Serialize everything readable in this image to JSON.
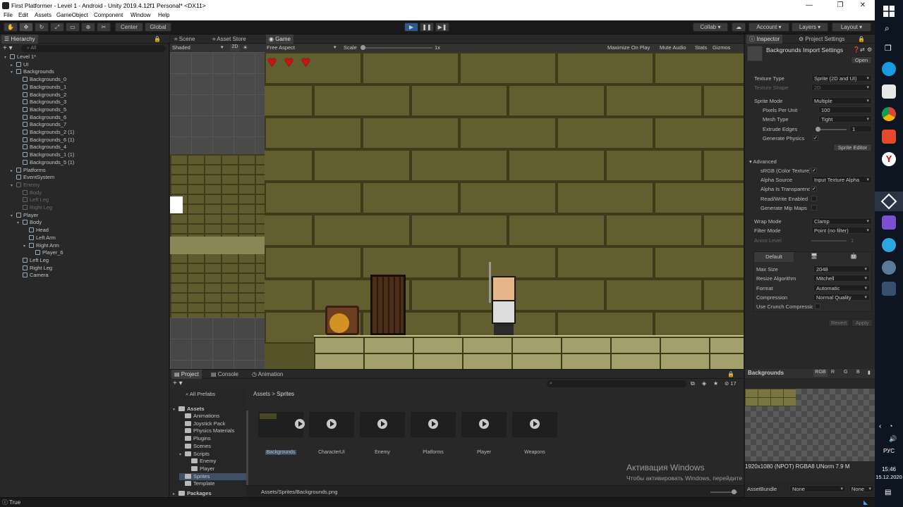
{
  "window": {
    "title": "First Platformer - Level 1 - Android - Unity 2019.4.12f1 Personal* <DX11>"
  },
  "menu": [
    "File",
    "Edit",
    "Assets",
    "GameObject",
    "Component",
    "Window",
    "Help"
  ],
  "toolbar": {
    "center_label": "Center",
    "global_label": "Global",
    "collab_label": "Collab",
    "account_label": "Account",
    "layers_label": "Layers",
    "layout_label": "Layout"
  },
  "hierarchy": {
    "title": "Hierarchy",
    "search_placeholder": "All",
    "items": [
      {
        "label": "Level 1*",
        "indent": 0,
        "dim": false
      },
      {
        "label": "UI",
        "indent": 1,
        "dim": false
      },
      {
        "label": "Backgrounds",
        "indent": 1,
        "dim": false
      },
      {
        "label": "Backgrounds_0",
        "indent": 2,
        "dim": false
      },
      {
        "label": "Backgrounds_1",
        "indent": 2,
        "dim": false
      },
      {
        "label": "Backgrounds_2",
        "indent": 2,
        "dim": false
      },
      {
        "label": "Backgrounds_3",
        "indent": 2,
        "dim": false
      },
      {
        "label": "Backgrounds_5",
        "indent": 2,
        "dim": false
      },
      {
        "label": "Backgrounds_6",
        "indent": 2,
        "dim": false
      },
      {
        "label": "Backgrounds_7",
        "indent": 2,
        "dim": false
      },
      {
        "label": "Backgrounds_2 (1)",
        "indent": 2,
        "dim": false
      },
      {
        "label": "Backgrounds_6 (1)",
        "indent": 2,
        "dim": false
      },
      {
        "label": "Backgrounds_4",
        "indent": 2,
        "dim": false
      },
      {
        "label": "Backgrounds_1 (1)",
        "indent": 2,
        "dim": false
      },
      {
        "label": "Backgrounds_5 (1)",
        "indent": 2,
        "dim": false
      },
      {
        "label": "Platforms",
        "indent": 1,
        "dim": false
      },
      {
        "label": "EventSystem",
        "indent": 1,
        "dim": false
      },
      {
        "label": "Enemy",
        "indent": 1,
        "dim": true
      },
      {
        "label": "Body",
        "indent": 2,
        "dim": true
      },
      {
        "label": "Left Leg",
        "indent": 2,
        "dim": true
      },
      {
        "label": "Right Leg",
        "indent": 2,
        "dim": true
      },
      {
        "label": "Player",
        "indent": 1,
        "dim": false
      },
      {
        "label": "Body",
        "indent": 2,
        "dim": false
      },
      {
        "label": "Head",
        "indent": 3,
        "dim": false
      },
      {
        "label": "Left Arm",
        "indent": 3,
        "dim": false
      },
      {
        "label": "Right Arm",
        "indent": 3,
        "dim": false
      },
      {
        "label": "Player_6",
        "indent": 4,
        "dim": false
      },
      {
        "label": "Left Leg",
        "indent": 2,
        "dim": false
      },
      {
        "label": "Right Leg",
        "indent": 2,
        "dim": false
      },
      {
        "label": "Camera",
        "indent": 2,
        "dim": false
      }
    ]
  },
  "scene": {
    "tabs": [
      "Scene",
      "Asset Store"
    ],
    "shading": "Shaded",
    "mode2d": "2D"
  },
  "game": {
    "tab": "Game",
    "aspect": "Free Aspect",
    "scale_label": "Scale",
    "scale_value": "1x",
    "buttons": [
      "Maximize On Play",
      "Mute Audio",
      "Stats",
      "Gizmos"
    ],
    "hearts": 3
  },
  "inspector": {
    "tabs": [
      "Inspector",
      "Project Settings"
    ],
    "title": "Backgrounds Import Settings",
    "open_label": "Open",
    "texture_type_label": "Texture Type",
    "texture_type": "Sprite (2D and UI)",
    "texture_shape_label": "Texture Shape",
    "texture_shape": "2D",
    "sprite_mode_label": "Sprite Mode",
    "sprite_mode": "Multiple",
    "ppu_label": "Pixels Per Unit",
    "ppu": "100",
    "mesh_type_label": "Mesh Type",
    "mesh_type": "Tight",
    "extrude_label": "Extrude Edges",
    "extrude": "1",
    "gen_physics_label": "Generate Physics",
    "sprite_editor_label": "Sprite Editor",
    "advanced_label": "Advanced",
    "srgb_label": "sRGB (Color Texture)",
    "alpha_source_label": "Alpha Source",
    "alpha_source": "Input Texture Alpha",
    "alpha_transp_label": "Alpha Is Transparency",
    "rw_label": "Read/Write Enabled",
    "mipmap_label": "Generate Mip Maps",
    "wrap_label": "Wrap Mode",
    "wrap": "Clamp",
    "filter_label": "Filter Mode",
    "filter": "Point (no filter)",
    "aniso_label": "Aniso Level",
    "aniso": "1",
    "platform_default": "Default",
    "max_size_label": "Max Size",
    "max_size": "2048",
    "resize_label": "Resize Algorithm",
    "resize": "Mitchell",
    "format_label": "Format",
    "format": "Automatic",
    "compression_label": "Compression",
    "compression": "Normal Quality",
    "crunch_label": "Use Crunch Compression",
    "revert_label": "Revert",
    "apply_label": "Apply"
  },
  "project": {
    "tabs": [
      "Project",
      "Console",
      "Animation"
    ],
    "all_prefabs": "All Prefabs",
    "tree_root": "Assets",
    "tree": [
      {
        "label": "Animations",
        "indent": 1
      },
      {
        "label": "Joystick Pack",
        "indent": 1
      },
      {
        "label": "Physics Materials",
        "indent": 1
      },
      {
        "label": "Plugins",
        "indent": 1
      },
      {
        "label": "Scenes",
        "indent": 1
      },
      {
        "label": "Scripts",
        "indent": 1
      },
      {
        "label": "Enemy",
        "indent": 2
      },
      {
        "label": "Player",
        "indent": 2
      },
      {
        "label": "Sprites",
        "indent": 1
      },
      {
        "label": "Template",
        "indent": 1
      }
    ],
    "packages_label": "Packages",
    "breadcrumb_root": "Assets",
    "breadcrumb_sep": ">",
    "breadcrumb_leaf": "Sprites",
    "hidden_count": "17",
    "assets": [
      "Backgrounds",
      "CharacterUI",
      "Enemy",
      "Platforms",
      "Player",
      "Weapons"
    ],
    "selected_path": "Assets/Sprites/Backgrounds.png"
  },
  "preview": {
    "title": "Backgrounds",
    "channels": [
      "RGB",
      "R",
      "G",
      "B"
    ],
    "info": "1920x1080 (NPOT)  RGBA8 UNorm   7.9 M",
    "assetbundle_label": "AssetBundle",
    "assetbundle_value": "None",
    "variant_value": "None"
  },
  "status": {
    "text": "True"
  },
  "watermark": {
    "line1": "Активация Windows",
    "line2": "Чтобы активировать Windows, перейдите в раздел \"Параметры\"."
  },
  "taskbar": {
    "lang": "РУС",
    "time": "15:46",
    "date": "15.12.2020"
  }
}
